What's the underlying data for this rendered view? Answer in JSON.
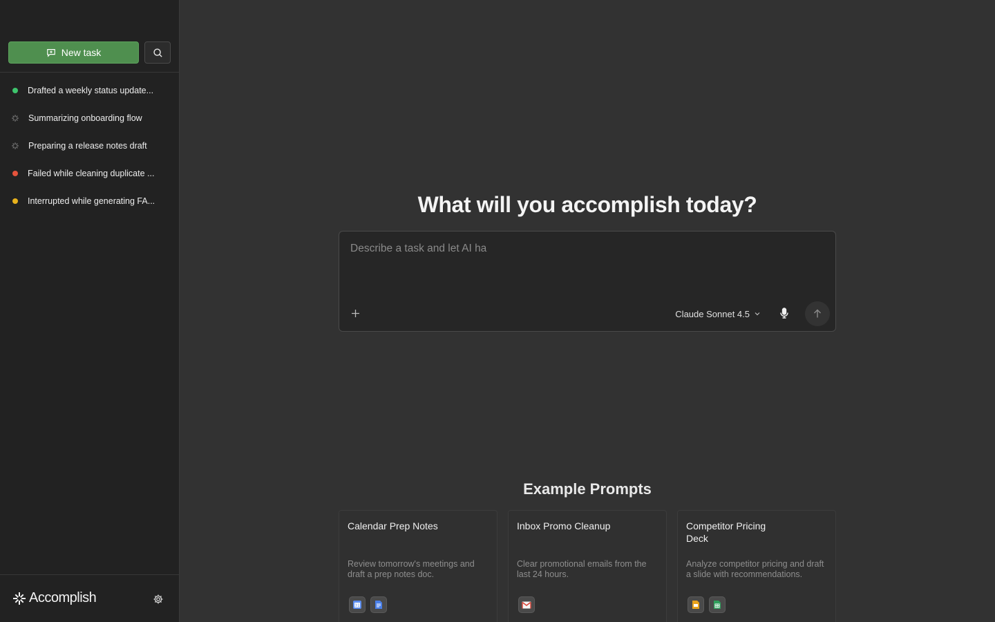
{
  "sidebar": {
    "new_task_label": "New task",
    "tasks": [
      {
        "label": "Drafted a weekly status update...",
        "status": "completed",
        "color": "#3ec46d"
      },
      {
        "label": "Summarizing onboarding flow",
        "status": "running",
        "color": "#8a8a8a"
      },
      {
        "label": "Preparing a release notes draft",
        "status": "running",
        "color": "#8a8a8a"
      },
      {
        "label": "Failed while cleaning duplicate ...",
        "status": "failed",
        "color": "#e5533c"
      },
      {
        "label": "Interrupted while generating FA...",
        "status": "interrupted",
        "color": "#e8b21c"
      }
    ],
    "brand_name": "Accomplish"
  },
  "main": {
    "headline": "What will you accomplish today?",
    "composer": {
      "placeholder": "Describe a task and let AI ha",
      "model": "Claude Sonnet 4.5"
    },
    "examples_title": "Example Prompts",
    "examples": [
      {
        "title": "Calendar Prep Notes",
        "description": "Review tomorrow's meetings and draft a prep notes doc.",
        "icons": [
          "google-calendar-icon",
          "google-docs-icon"
        ]
      },
      {
        "title": "Inbox Promo Cleanup",
        "description": "Clear promotional emails from the last 24 hours.",
        "icons": [
          "gmail-icon"
        ]
      },
      {
        "title": "Competitor Pricing Deck",
        "description": "Analyze competitor pricing and draft a slide with recommendations.",
        "icons": [
          "google-slides-icon",
          "google-sheets-icon"
        ]
      }
    ]
  },
  "colors": {
    "accent_green": "#4f8f4f",
    "background": "#323232",
    "sidebar": "#222222"
  }
}
